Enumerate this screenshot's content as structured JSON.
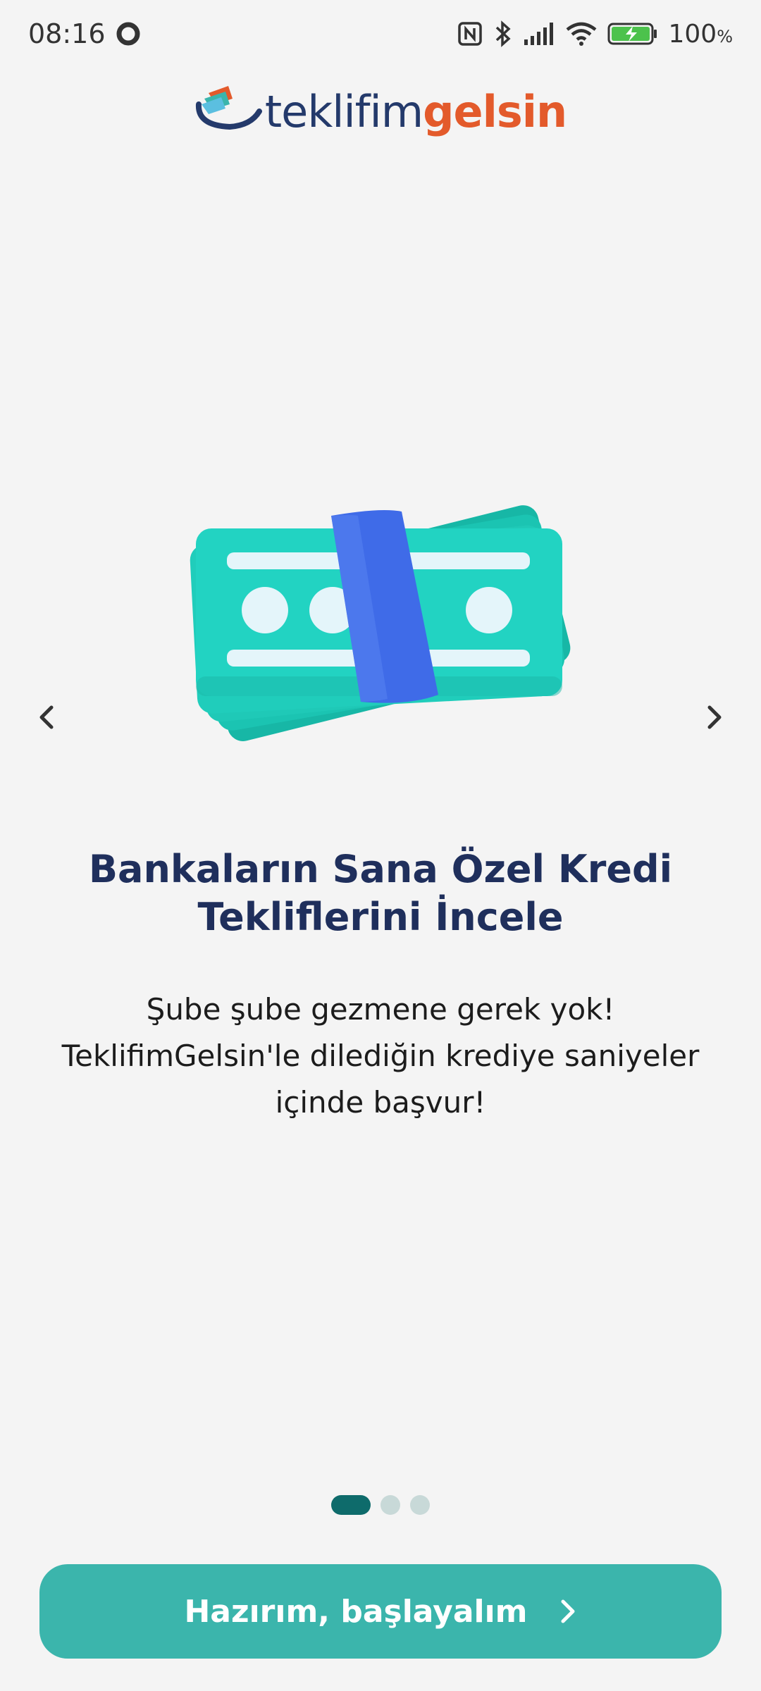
{
  "status_bar": {
    "time": "08:16",
    "battery": "100",
    "battery_unit": "%"
  },
  "logo": {
    "part1": "teklifim",
    "part2": "gelsin",
    "colors": {
      "dark": "#243a6b",
      "accent": "#e35a2b"
    }
  },
  "slide": {
    "title_line1": "Bankaların Sana Özel Kredi",
    "title_line2": "Tekliflerini İncele",
    "desc_line1": "Şube şube gezmene gerek yok!",
    "desc_line2": "TeklifimGelsin'le dilediğin krediye saniyeler",
    "desc_line3": "içinde başvur!",
    "illustration_icon": "money-stack-icon"
  },
  "pagination": {
    "total": 3,
    "current": 1
  },
  "cta": {
    "label": "Hazırım, başlayalım",
    "color": "#3bb5ac"
  }
}
